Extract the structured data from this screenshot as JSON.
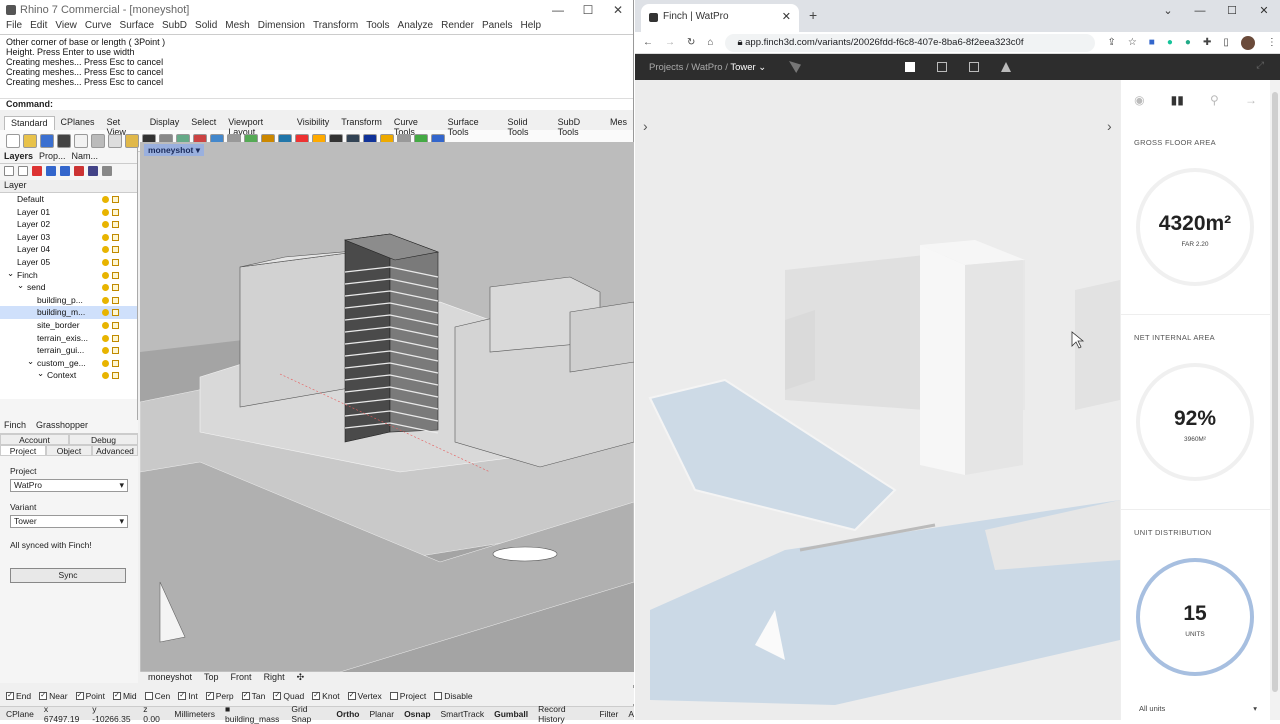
{
  "rhino": {
    "title": "Rhino 7 Commercial - [moneyshot]",
    "menu": [
      "File",
      "Edit",
      "View",
      "Curve",
      "Surface",
      "SubD",
      "Solid",
      "Mesh",
      "Dimension",
      "Transform",
      "Tools",
      "Analyze",
      "Render",
      "Panels",
      "Help"
    ],
    "command_history": [
      "Other corner of base or length ( 3Point )",
      "Height. Press Enter to use width",
      "Creating meshes... Press Esc to cancel",
      "Creating meshes... Press Esc to cancel",
      "Creating meshes... Press Esc to cancel"
    ],
    "command_prompt": "Command:",
    "toolbar_tabs": [
      "Standard",
      "CPlanes",
      "Set View",
      "Display",
      "Select",
      "Viewport Layout",
      "Visibility",
      "Transform",
      "Curve Tools",
      "Surface Tools",
      "Solid Tools",
      "SubD Tools",
      "Mes"
    ],
    "panel_tabs": [
      "Layers",
      "Prop...",
      "Nam..."
    ],
    "layer_header": "Layer",
    "layers": [
      {
        "name": "Default",
        "indent": 0
      },
      {
        "name": "Layer 01",
        "indent": 0
      },
      {
        "name": "Layer 02",
        "indent": 0
      },
      {
        "name": "Layer 03",
        "indent": 0
      },
      {
        "name": "Layer 04",
        "indent": 0
      },
      {
        "name": "Layer 05",
        "indent": 0
      },
      {
        "name": "Finch",
        "indent": 0
      },
      {
        "name": "send",
        "indent": 1
      },
      {
        "name": "building_p...",
        "indent": 2
      },
      {
        "name": "building_m...",
        "indent": 2,
        "selected": true
      },
      {
        "name": "site_border",
        "indent": 2
      },
      {
        "name": "terrain_exis...",
        "indent": 2
      },
      {
        "name": "terrain_gui...",
        "indent": 2
      },
      {
        "name": "custom_ge...",
        "indent": 2
      },
      {
        "name": "Context",
        "indent": 3
      }
    ],
    "finch_tabs": [
      "Finch",
      "Grasshopper"
    ],
    "finch_subtabs_row1": [
      "Account",
      "Debug"
    ],
    "finch_subtabs_row2": [
      "Project",
      "Object",
      "Advanced"
    ],
    "project_label": "Project",
    "project_value": "WatPro",
    "variant_label": "Variant",
    "variant_value": "Tower",
    "sync_status": "All synced with Finch!",
    "sync_button": "Sync",
    "viewport_title": "moneyshot",
    "viewport_tabs": [
      "moneyshot",
      "Top",
      "Front",
      "Right"
    ],
    "osnaps": [
      {
        "label": "End",
        "checked": true
      },
      {
        "label": "Near",
        "checked": true
      },
      {
        "label": "Point",
        "checked": true
      },
      {
        "label": "Mid",
        "checked": true
      },
      {
        "label": "Cen",
        "checked": false
      },
      {
        "label": "Int",
        "checked": true
      },
      {
        "label": "Perp",
        "checked": true
      },
      {
        "label": "Tan",
        "checked": true
      },
      {
        "label": "Quad",
        "checked": true
      },
      {
        "label": "Knot",
        "checked": true
      },
      {
        "label": "Vertex",
        "checked": true
      },
      {
        "label": "Project",
        "checked": false
      },
      {
        "label": "Disable",
        "checked": false
      }
    ],
    "status": {
      "cplane": "CPlane",
      "x": "x 67497.19",
      "y": "y -10266.35",
      "z": "z 0.00",
      "units": "Millimeters",
      "layer": "building_mass",
      "items": [
        "Grid Snap",
        "Ortho",
        "Planar",
        "Osnap",
        "SmartTrack",
        "Gumball",
        "Record History",
        "Filter",
        "A"
      ]
    }
  },
  "browser": {
    "tab_title": "Finch | WatPro",
    "url": "app.finch3d.com/variants/20026fdd-f6c8-407e-8ba6-8f2eea323c0f",
    "breadcrumb": [
      "Projects",
      "WatPro",
      "Tower"
    ],
    "metrics": [
      {
        "label": "GROSS FLOOR AREA",
        "value": "4320m²",
        "sub": "FAR 2.20"
      },
      {
        "label": "NET INTERNAL AREA",
        "value": "92%",
        "sub": "3960M²"
      },
      {
        "label": "UNIT DISTRIBUTION",
        "value": "15",
        "sub": "UNITS"
      }
    ],
    "units_filter": "All units"
  }
}
